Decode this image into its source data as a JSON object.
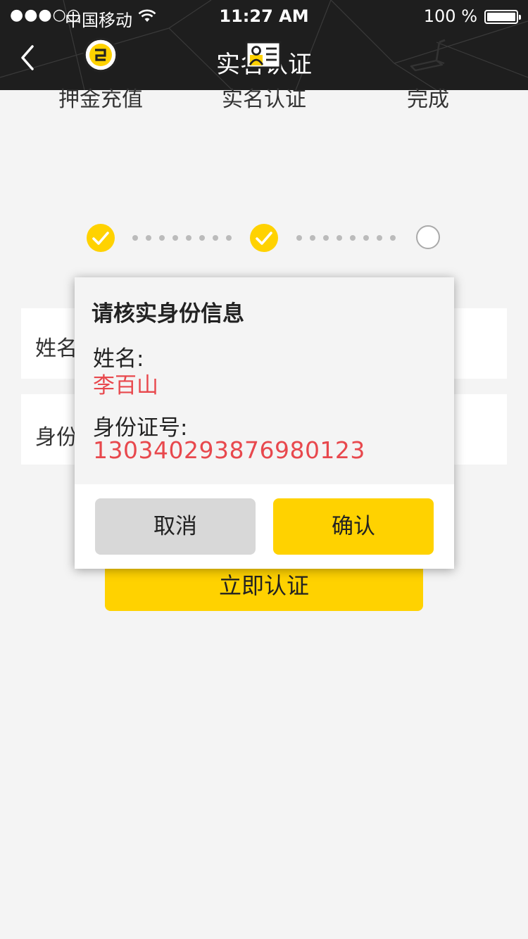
{
  "status_bar": {
    "signal": "●●●○○",
    "carrier": "中国移动",
    "time": "11:27 AM",
    "battery": "100 %"
  },
  "nav": {
    "title": "实名认证"
  },
  "steps": [
    {
      "label": "押金充值",
      "icon": "coin-icon",
      "state": "done"
    },
    {
      "label": "实名认证",
      "icon": "id-card-icon",
      "state": "done"
    },
    {
      "label": "完成",
      "icon": "treadmill-icon",
      "state": "pending"
    }
  ],
  "form": {
    "name_label": "姓名",
    "id_label": "身份",
    "submit_label": "立即认证"
  },
  "dialog": {
    "title": "请核实身份信息",
    "name_label": "姓名:",
    "name_value": "李百山",
    "id_label": "身份证号:",
    "id_value": "130340293876980123",
    "cancel_label": "取消",
    "confirm_label": "确认"
  },
  "colors": {
    "accent": "#ffd200",
    "header_bg": "#1e1e1e",
    "highlight_text": "#e8484d",
    "page_bg": "#f4f4f4"
  }
}
